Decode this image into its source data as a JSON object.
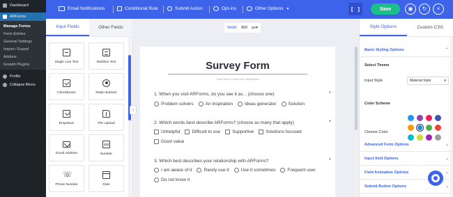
{
  "wp_sidebar": {
    "dashboard": "Dashboard",
    "arforms": "ARForms",
    "submenu": [
      "Manage Forms",
      "Form Entries",
      "General Settings",
      "Import / Export",
      "Addons",
      "Growth Plugins"
    ],
    "profile": "Profile",
    "collapse": "Collapse Menu"
  },
  "toolbar": {
    "email_notifications": "Email Notifications",
    "conditional_rule": "Conditional Rule",
    "submit_action": "Submit Action",
    "opt_ins": "Opt-ins",
    "other_options": "Other Options",
    "code_label": "[ ]",
    "save_label": "Save"
  },
  "fields_panel": {
    "tabs": [
      "Input Fields",
      "Other Fields"
    ],
    "items": [
      {
        "label": "Single Line Text",
        "icon": "single-line-text-icon"
      },
      {
        "label": "Multiline Text",
        "icon": "multiline-text-icon"
      },
      {
        "label": "Checkboxes",
        "icon": "checkbox-icon"
      },
      {
        "label": "Radio Buttons",
        "icon": "radio-icon"
      },
      {
        "label": "Dropdown",
        "icon": "dropdown-icon"
      },
      {
        "label": "File Upload",
        "icon": "file-upload-icon"
      },
      {
        "label": "Email Address",
        "icon": "email-icon"
      },
      {
        "label": "Number",
        "icon": "number-icon",
        "glyph": "123"
      },
      {
        "label": "Phone Number",
        "icon": "phone-icon"
      },
      {
        "label": "Date",
        "icon": "calendar-icon"
      }
    ]
  },
  "canvas": {
    "width_label": "Width",
    "width_value": "800",
    "width_unit": "px",
    "form_title": "Survey Form",
    "form_description_placeholder": "Click here to enter form description",
    "questions": [
      {
        "text": "1. When you visit ARForms, do you see it as... (choose one)",
        "type": "radio",
        "options": [
          "Problem solvers",
          "An inspiration",
          "Ideas generator",
          "Solution"
        ]
      },
      {
        "text": "2. Which words best describe ARForms? (choose as many that apply)",
        "type": "checkbox",
        "options": [
          "Unhelpful",
          "Difficult to use",
          "Supportive",
          "Solutions focused",
          "Good value"
        ]
      },
      {
        "text": "3. Which best describes your relationship with ARForms?",
        "type": "radio",
        "options": [
          "I am aware of it",
          "Rarely use it",
          "Use it sometimes",
          "Frequent user",
          "Do not know it"
        ]
      }
    ],
    "required_mark": "*"
  },
  "style_panel": {
    "tabs": [
      "Style Options",
      "Custom CSS"
    ],
    "basic_styling": "Basic Styling Options",
    "select_theme": "Select Theme",
    "input_style_label": "Input Style",
    "input_style_value": "Material Style",
    "color_scheme": "Color Scheme",
    "choose_color": "Choose Color",
    "colors": [
      "#2196f3",
      "#8e44ad",
      "#e91e63",
      "#3f51b5",
      "#ff9800",
      "#1e88e5",
      "#4caf50",
      "#f44336",
      "#00bcd4",
      "#cddc39",
      "#9c27b0",
      "#9e9e9e"
    ],
    "selected_color_index": 5,
    "sections": [
      "Advanced Form Options",
      "Input field Options",
      "Field Animation Options",
      "Submit Button Options"
    ]
  }
}
